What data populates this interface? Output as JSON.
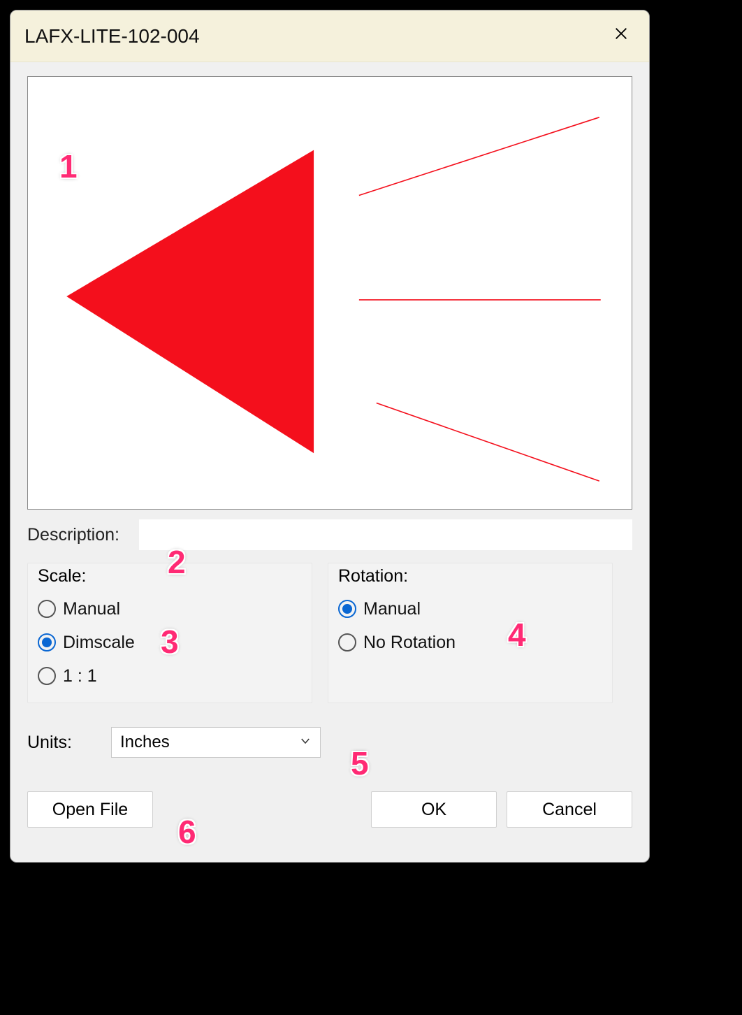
{
  "title": "LAFX-LITE-102-004",
  "description": {
    "label": "Description:",
    "value": ""
  },
  "scale": {
    "label": "Scale:",
    "options": [
      {
        "key": "manual",
        "label": "Manual",
        "selected": false
      },
      {
        "key": "dimscale",
        "label": "Dimscale",
        "selected": true
      },
      {
        "key": "one",
        "label": "1 : 1",
        "selected": false
      }
    ]
  },
  "rotation": {
    "label": "Rotation:",
    "options": [
      {
        "key": "manual",
        "label": "Manual",
        "selected": true
      },
      {
        "key": "none",
        "label": "No Rotation",
        "selected": false
      }
    ]
  },
  "units": {
    "label": "Units:",
    "value": "Inches"
  },
  "buttons": {
    "open": "Open File",
    "ok": "OK",
    "cancel": "Cancel"
  },
  "annotations": [
    "1",
    "2",
    "3",
    "4",
    "5",
    "6"
  ]
}
